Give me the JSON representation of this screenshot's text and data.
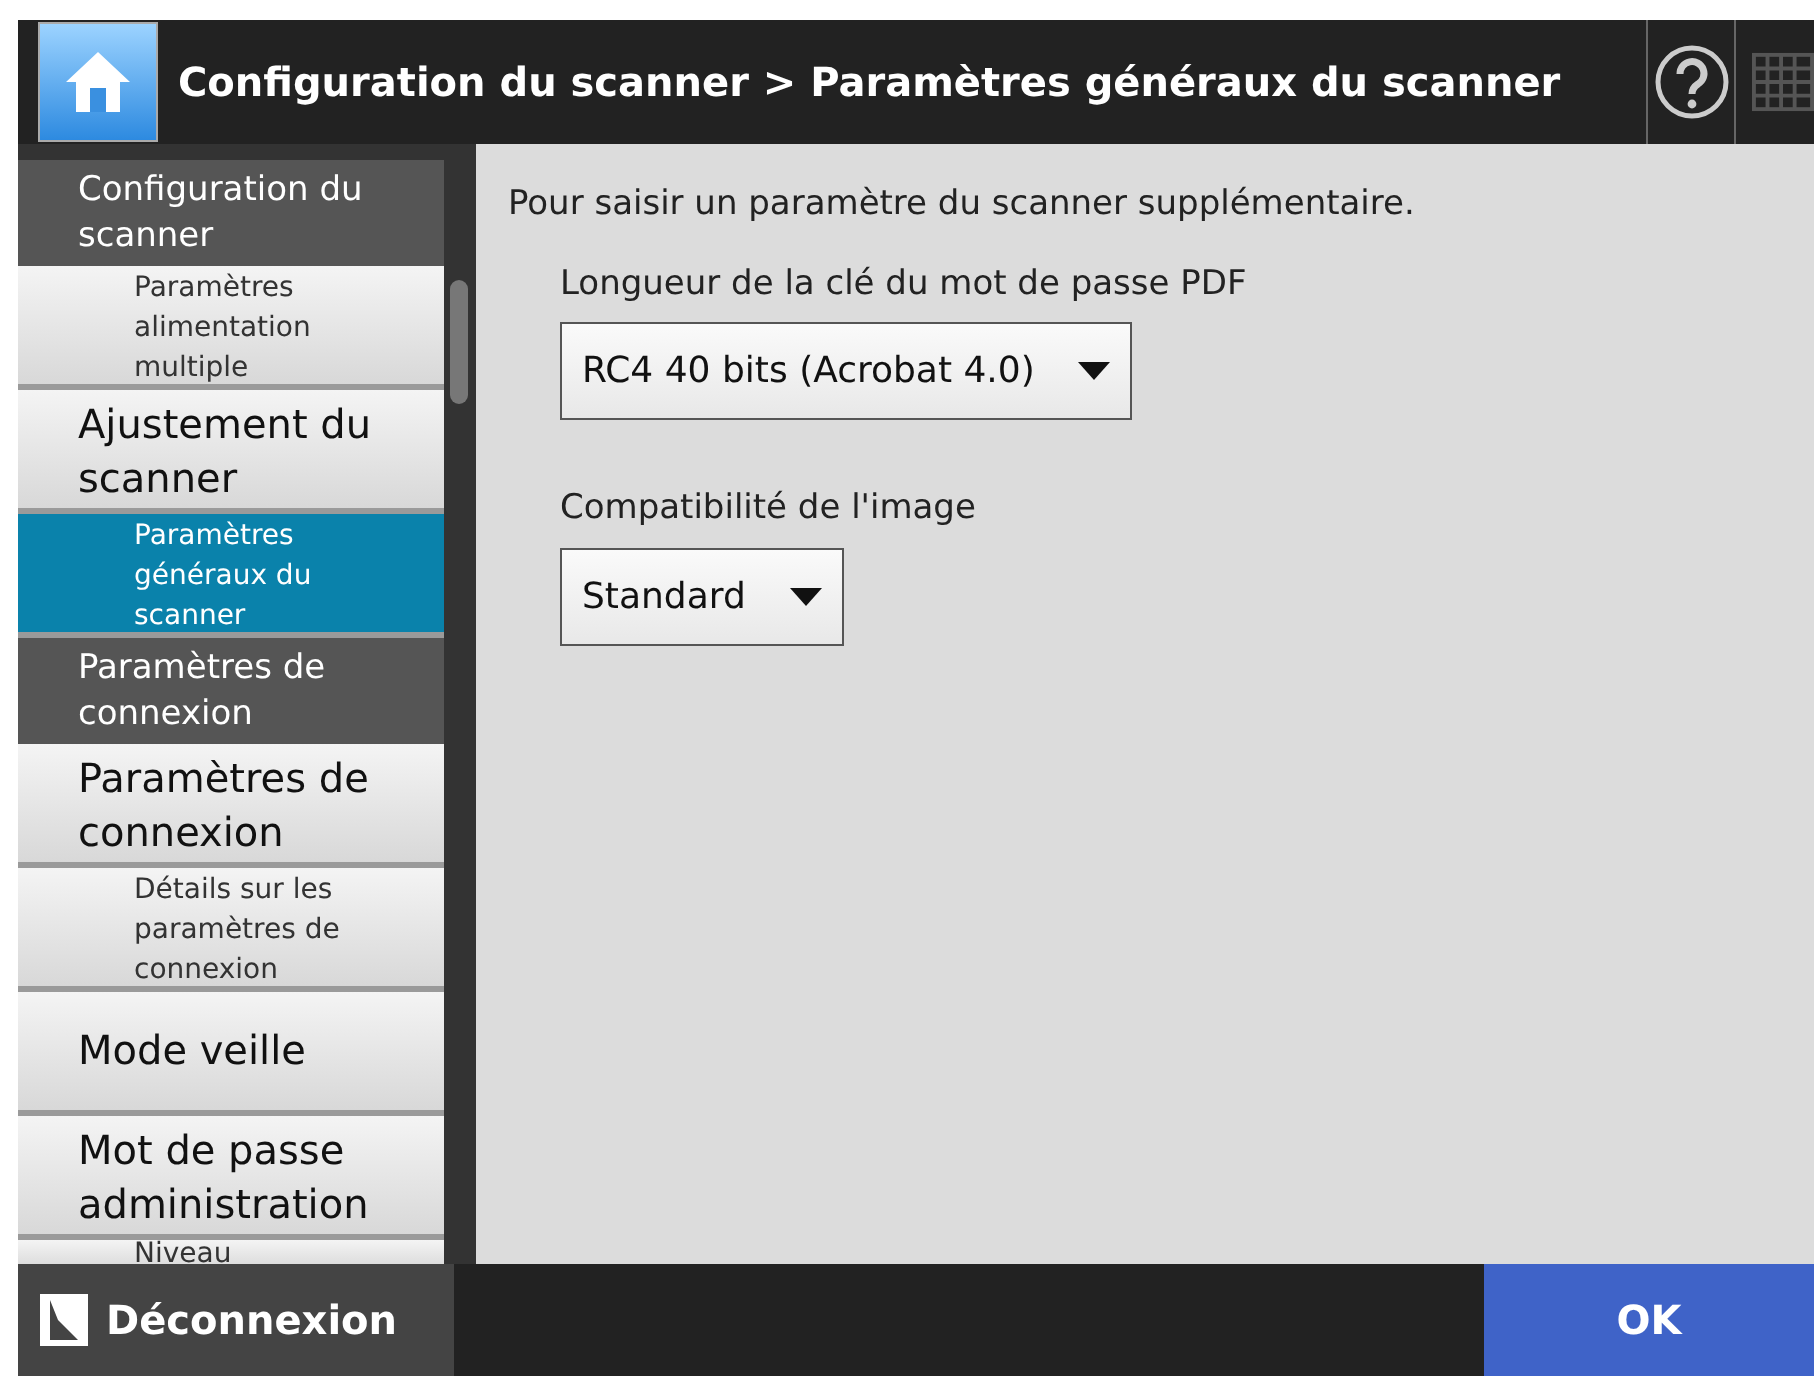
{
  "header": {
    "title": "Configuration du scanner > Paramètres généraux du scanner"
  },
  "sidebar": {
    "items": [
      {
        "kind": "header",
        "label": "Configuration du scanner",
        "selected": false
      },
      {
        "kind": "sub",
        "label": "Paramètres alimentation multiple",
        "selected": false
      },
      {
        "kind": "item",
        "label": "Ajustement du scanner",
        "selected": false
      },
      {
        "kind": "sub",
        "label": "Paramètres généraux du scanner",
        "selected": true
      },
      {
        "kind": "header",
        "label": "Paramètres de connexion",
        "selected": false
      },
      {
        "kind": "item",
        "label": "Paramètres de connexion",
        "selected": false
      },
      {
        "kind": "sub",
        "label": "Détails sur les paramètres de connexion",
        "selected": false
      },
      {
        "kind": "item",
        "label": "Mode veille",
        "selected": false
      },
      {
        "kind": "item",
        "label": "Mot de passe administration",
        "selected": false
      },
      {
        "kind": "sub",
        "label": "Niveau",
        "selected": false
      }
    ]
  },
  "main": {
    "intro": "Pour saisir un paramètre du scanner supplémentaire.",
    "settings": [
      {
        "label": "Longueur de la clé du mot de passe PDF",
        "value": "RC4 40 bits (Acrobat 4.0)"
      },
      {
        "label": "Compatibilité de l'image",
        "value": "Standard"
      }
    ]
  },
  "footer": {
    "logout": "Déconnexion",
    "ok": "OK"
  }
}
